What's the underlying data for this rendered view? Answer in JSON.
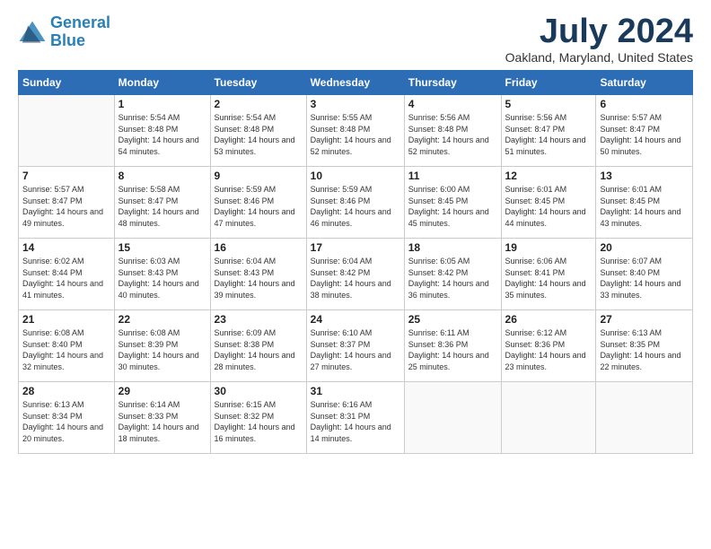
{
  "logo": {
    "line1": "General",
    "line2": "Blue"
  },
  "title": "July 2024",
  "location": "Oakland, Maryland, United States",
  "days_header": [
    "Sunday",
    "Monday",
    "Tuesday",
    "Wednesday",
    "Thursday",
    "Friday",
    "Saturday"
  ],
  "weeks": [
    [
      {
        "day": "",
        "sunrise": "",
        "sunset": "",
        "daylight": ""
      },
      {
        "day": "1",
        "sunrise": "Sunrise: 5:54 AM",
        "sunset": "Sunset: 8:48 PM",
        "daylight": "Daylight: 14 hours and 54 minutes."
      },
      {
        "day": "2",
        "sunrise": "Sunrise: 5:54 AM",
        "sunset": "Sunset: 8:48 PM",
        "daylight": "Daylight: 14 hours and 53 minutes."
      },
      {
        "day": "3",
        "sunrise": "Sunrise: 5:55 AM",
        "sunset": "Sunset: 8:48 PM",
        "daylight": "Daylight: 14 hours and 52 minutes."
      },
      {
        "day": "4",
        "sunrise": "Sunrise: 5:56 AM",
        "sunset": "Sunset: 8:48 PM",
        "daylight": "Daylight: 14 hours and 52 minutes."
      },
      {
        "day": "5",
        "sunrise": "Sunrise: 5:56 AM",
        "sunset": "Sunset: 8:47 PM",
        "daylight": "Daylight: 14 hours and 51 minutes."
      },
      {
        "day": "6",
        "sunrise": "Sunrise: 5:57 AM",
        "sunset": "Sunset: 8:47 PM",
        "daylight": "Daylight: 14 hours and 50 minutes."
      }
    ],
    [
      {
        "day": "7",
        "sunrise": "Sunrise: 5:57 AM",
        "sunset": "Sunset: 8:47 PM",
        "daylight": "Daylight: 14 hours and 49 minutes."
      },
      {
        "day": "8",
        "sunrise": "Sunrise: 5:58 AM",
        "sunset": "Sunset: 8:47 PM",
        "daylight": "Daylight: 14 hours and 48 minutes."
      },
      {
        "day": "9",
        "sunrise": "Sunrise: 5:59 AM",
        "sunset": "Sunset: 8:46 PM",
        "daylight": "Daylight: 14 hours and 47 minutes."
      },
      {
        "day": "10",
        "sunrise": "Sunrise: 5:59 AM",
        "sunset": "Sunset: 8:46 PM",
        "daylight": "Daylight: 14 hours and 46 minutes."
      },
      {
        "day": "11",
        "sunrise": "Sunrise: 6:00 AM",
        "sunset": "Sunset: 8:45 PM",
        "daylight": "Daylight: 14 hours and 45 minutes."
      },
      {
        "day": "12",
        "sunrise": "Sunrise: 6:01 AM",
        "sunset": "Sunset: 8:45 PM",
        "daylight": "Daylight: 14 hours and 44 minutes."
      },
      {
        "day": "13",
        "sunrise": "Sunrise: 6:01 AM",
        "sunset": "Sunset: 8:45 PM",
        "daylight": "Daylight: 14 hours and 43 minutes."
      }
    ],
    [
      {
        "day": "14",
        "sunrise": "Sunrise: 6:02 AM",
        "sunset": "Sunset: 8:44 PM",
        "daylight": "Daylight: 14 hours and 41 minutes."
      },
      {
        "day": "15",
        "sunrise": "Sunrise: 6:03 AM",
        "sunset": "Sunset: 8:43 PM",
        "daylight": "Daylight: 14 hours and 40 minutes."
      },
      {
        "day": "16",
        "sunrise": "Sunrise: 6:04 AM",
        "sunset": "Sunset: 8:43 PM",
        "daylight": "Daylight: 14 hours and 39 minutes."
      },
      {
        "day": "17",
        "sunrise": "Sunrise: 6:04 AM",
        "sunset": "Sunset: 8:42 PM",
        "daylight": "Daylight: 14 hours and 38 minutes."
      },
      {
        "day": "18",
        "sunrise": "Sunrise: 6:05 AM",
        "sunset": "Sunset: 8:42 PM",
        "daylight": "Daylight: 14 hours and 36 minutes."
      },
      {
        "day": "19",
        "sunrise": "Sunrise: 6:06 AM",
        "sunset": "Sunset: 8:41 PM",
        "daylight": "Daylight: 14 hours and 35 minutes."
      },
      {
        "day": "20",
        "sunrise": "Sunrise: 6:07 AM",
        "sunset": "Sunset: 8:40 PM",
        "daylight": "Daylight: 14 hours and 33 minutes."
      }
    ],
    [
      {
        "day": "21",
        "sunrise": "Sunrise: 6:08 AM",
        "sunset": "Sunset: 8:40 PM",
        "daylight": "Daylight: 14 hours and 32 minutes."
      },
      {
        "day": "22",
        "sunrise": "Sunrise: 6:08 AM",
        "sunset": "Sunset: 8:39 PM",
        "daylight": "Daylight: 14 hours and 30 minutes."
      },
      {
        "day": "23",
        "sunrise": "Sunrise: 6:09 AM",
        "sunset": "Sunset: 8:38 PM",
        "daylight": "Daylight: 14 hours and 28 minutes."
      },
      {
        "day": "24",
        "sunrise": "Sunrise: 6:10 AM",
        "sunset": "Sunset: 8:37 PM",
        "daylight": "Daylight: 14 hours and 27 minutes."
      },
      {
        "day": "25",
        "sunrise": "Sunrise: 6:11 AM",
        "sunset": "Sunset: 8:36 PM",
        "daylight": "Daylight: 14 hours and 25 minutes."
      },
      {
        "day": "26",
        "sunrise": "Sunrise: 6:12 AM",
        "sunset": "Sunset: 8:36 PM",
        "daylight": "Daylight: 14 hours and 23 minutes."
      },
      {
        "day": "27",
        "sunrise": "Sunrise: 6:13 AM",
        "sunset": "Sunset: 8:35 PM",
        "daylight": "Daylight: 14 hours and 22 minutes."
      }
    ],
    [
      {
        "day": "28",
        "sunrise": "Sunrise: 6:13 AM",
        "sunset": "Sunset: 8:34 PM",
        "daylight": "Daylight: 14 hours and 20 minutes."
      },
      {
        "day": "29",
        "sunrise": "Sunrise: 6:14 AM",
        "sunset": "Sunset: 8:33 PM",
        "daylight": "Daylight: 14 hours and 18 minutes."
      },
      {
        "day": "30",
        "sunrise": "Sunrise: 6:15 AM",
        "sunset": "Sunset: 8:32 PM",
        "daylight": "Daylight: 14 hours and 16 minutes."
      },
      {
        "day": "31",
        "sunrise": "Sunrise: 6:16 AM",
        "sunset": "Sunset: 8:31 PM",
        "daylight": "Daylight: 14 hours and 14 minutes."
      },
      {
        "day": "",
        "sunrise": "",
        "sunset": "",
        "daylight": ""
      },
      {
        "day": "",
        "sunrise": "",
        "sunset": "",
        "daylight": ""
      },
      {
        "day": "",
        "sunrise": "",
        "sunset": "",
        "daylight": ""
      }
    ]
  ]
}
